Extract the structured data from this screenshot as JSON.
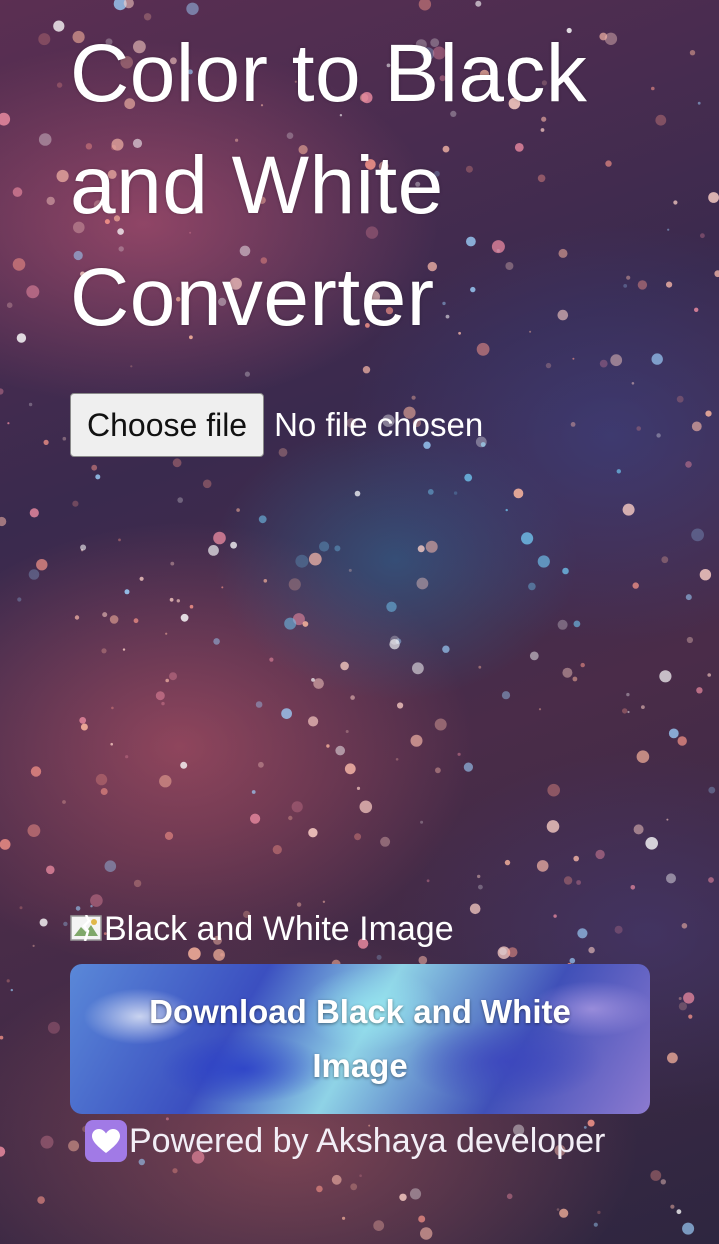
{
  "header": {
    "title": "Color to Black and White Converter"
  },
  "file_input": {
    "button_label": "Choose file",
    "status_text": "No file chosen"
  },
  "result_image": {
    "alt_text": "Black and White Image",
    "icon": "broken-image-icon"
  },
  "download": {
    "label": "Download Black and White Image"
  },
  "footer": {
    "icon": "white-heart-icon",
    "text": "Powered by Akshaya developer"
  },
  "colors": {
    "text": "#ffffff",
    "heart_badge": "#a17ae6",
    "file_button_bg": "#efefef"
  }
}
